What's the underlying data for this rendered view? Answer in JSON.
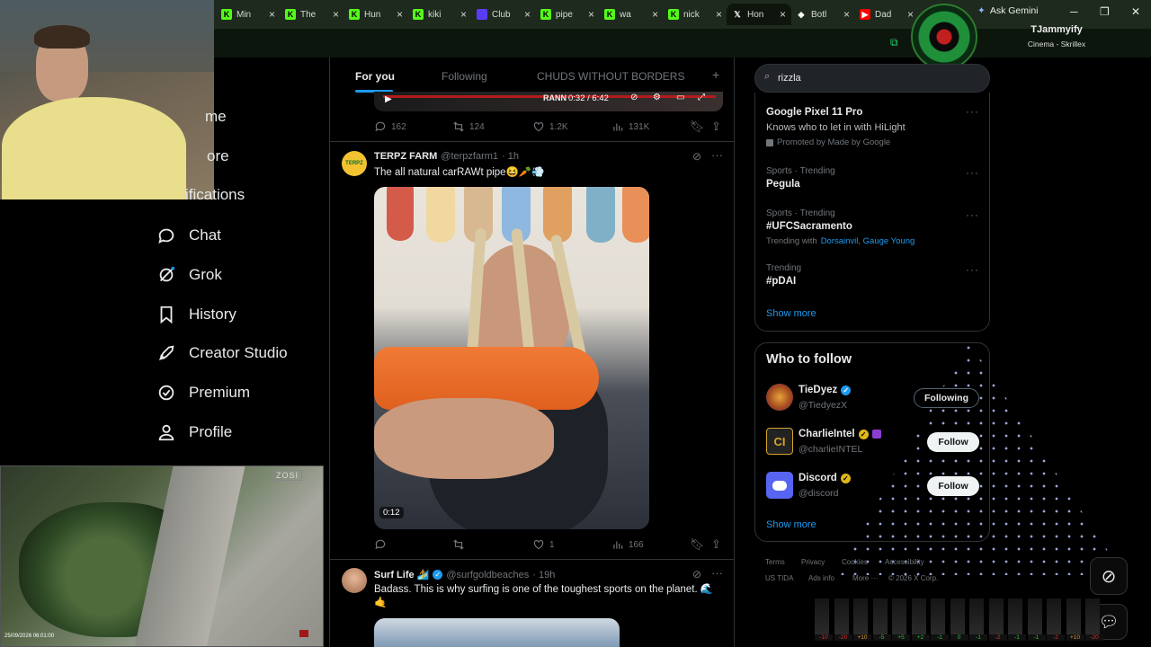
{
  "browser": {
    "tabs": [
      {
        "title": "Min",
        "icon": "kick-icon",
        "color": "#53fc18"
      },
      {
        "title": "The",
        "icon": "kick-icon",
        "color": "#53fc18"
      },
      {
        "title": "Hun",
        "icon": "kick-icon",
        "color": "#53fc18"
      },
      {
        "title": "kiki",
        "icon": "kick-icon",
        "color": "#53fc18"
      },
      {
        "title": "Club",
        "icon": "club-icon",
        "color": "#5b3cf5"
      },
      {
        "title": "pipe",
        "icon": "kick-icon",
        "color": "#53fc18"
      },
      {
        "title": "wa",
        "icon": "kick-icon",
        "color": "#53fc18"
      },
      {
        "title": "nick",
        "icon": "kick-icon",
        "color": "#53fc18"
      },
      {
        "title": "Hon",
        "icon": "x-icon",
        "color": "#ffffff"
      },
      {
        "title": "Botl",
        "icon": "bot-icon",
        "color": "#ffffff"
      },
      {
        "title": "Dad",
        "icon": "youtube-icon",
        "color": "#ff0000"
      }
    ],
    "close_glyph": "×",
    "gemini_label": "Ask Gemini",
    "profile_name": "TJammyify",
    "now_playing": "Cinema - Skrillex"
  },
  "nav": {
    "items": [
      {
        "label": "me",
        "icon": "home-icon"
      },
      {
        "label": "ore",
        "icon": "explore-icon"
      },
      {
        "label": "ifications",
        "icon": "bell-icon"
      },
      {
        "label": "Chat",
        "icon": "chat-icon"
      },
      {
        "label": "Grok",
        "icon": "grok-icon"
      },
      {
        "label": "History",
        "icon": "bookmark-icon"
      },
      {
        "label": "Creator Studio",
        "icon": "rocket-icon"
      },
      {
        "label": "Premium",
        "icon": "premium-icon"
      },
      {
        "label": "Profile",
        "icon": "person-icon"
      }
    ]
  },
  "feed": {
    "tabs": [
      "For you",
      "Following",
      "CHUDS WITHOUT BORDERS"
    ],
    "plus": "+",
    "prev_video_time": "0:32 / 6:42",
    "prev_video_label": "RANN",
    "prev_actions": {
      "replies": "162",
      "reposts": "124",
      "likes": "1.2K",
      "views": "131K"
    },
    "post1": {
      "name": "TERPZ FARM",
      "handle": "@terpzfarm1",
      "time": "· 1h",
      "text": "The all natural carRAWt pipe😆🥕💨",
      "video_time": "0:12",
      "actions": {
        "replies": "",
        "reposts": "",
        "likes": "1",
        "views": "166"
      }
    },
    "post2": {
      "name": "Surf Life 🏄",
      "handle": "@surfgoldbeaches",
      "time": "· 19h",
      "text": "Badass. This is why surfing is one of the toughest sports on the planet. 🌊🤙"
    }
  },
  "search": {
    "value": "rizzla"
  },
  "trends": [
    {
      "category": "",
      "name": "Google Pixel 11 Pro",
      "desc": "Knows who to let in with HiLight",
      "promo": "Promoted by Made by Google"
    },
    {
      "category": "Sports · Trending",
      "name": "Pegula"
    },
    {
      "category": "Sports · Trending",
      "name": "#UFCSacramento",
      "with_label": "Trending with",
      "with_links": "Dorsainvil, Gauge Young"
    },
    {
      "category": "Trending",
      "name": "#pDAI"
    }
  ],
  "show_more": "Show more",
  "who_to_follow": {
    "title": "Who to follow",
    "users": [
      {
        "name": "TieDyez",
        "handle": "@TiedyezX",
        "button": "Following"
      },
      {
        "name": "CharlieIntel",
        "handle": "@charlieINTEL",
        "button": "Follow"
      },
      {
        "name": "Discord",
        "handle": "@discord",
        "button": "Follow"
      }
    ]
  },
  "footer": {
    "links": [
      "Terms",
      "Privacy",
      "Cookies",
      "Accessibility",
      "US TIDA",
      "Ads info",
      "More ···",
      "© 2026 X Corp."
    ]
  },
  "cam": {
    "brand": "ZOSI",
    "timestamp": "25/09/2026 06:01:00"
  },
  "meter": [
    "-10",
    "-20",
    "+10",
    "-5",
    "+5",
    "+2",
    "-1",
    "0",
    "-1",
    "-2",
    "-1",
    "-1",
    "-2",
    "+10",
    "-20"
  ],
  "colors": {
    "accent": "#1d9bf0",
    "bg": "#000000",
    "border": "#2f3336",
    "muted": "#71767b"
  }
}
